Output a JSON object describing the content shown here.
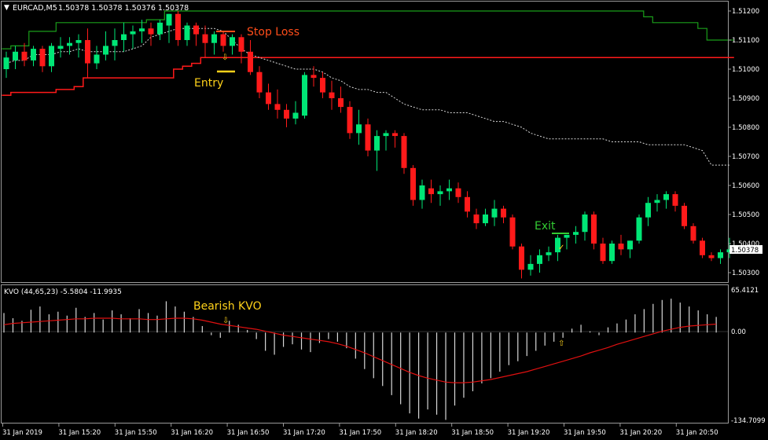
{
  "header": {
    "symbol": "EURCAD,M5",
    "ohlc": "1.50378 1.50378 1.50376 1.50378"
  },
  "annotations": {
    "stop_loss": "Stop Loss",
    "entry": "Entry",
    "exit": "Exit",
    "bearish_kvo": "Bearish KVO"
  },
  "indicator": {
    "label": "KVO (44,65,23)  -5.5804 -11.9935",
    "max_label": "65.4121",
    "zero_label": "0.00",
    "min_label": "-134.7099"
  },
  "current_price": "1.50378",
  "colors": {
    "bull": "#00e676",
    "bear": "#ff1a1a",
    "upper_band": "#1a9e1a",
    "lower_band": "#ff1a1a",
    "mid_band": "#d8d8d8",
    "kvo_hist": "#d8d8d8",
    "kvo_signal": "#e01010",
    "annotation_stop": "#ff4d1a",
    "annotation_entry": "#ffd21a",
    "annotation_exit": "#33cc33"
  },
  "chart_data": [
    {
      "type": "candlestick",
      "title": "EURCAD,M5",
      "ylim": [
        1.5025,
        1.5125
      ],
      "price_ticks": [
        "1.51200",
        "1.51100",
        "1.51000",
        "1.50900",
        "1.50800",
        "1.50700",
        "1.50600",
        "1.50500",
        "1.50400",
        "1.50300"
      ],
      "x_ticks": [
        "31 Jan 2019",
        "31 Jan 15:20",
        "31 Jan 15:50",
        "31 Jan 16:20",
        "31 Jan 16:50",
        "31 Jan 17:20",
        "31 Jan 17:50",
        "31 Jan 18:20",
        "31 Jan 18:50",
        "31 Jan 19:20",
        "31 Jan 19:50",
        "31 Jan 20:20",
        "31 Jan 20:50"
      ],
      "candles": [
        [
          1.51,
          1.5106,
          1.5097,
          1.5104
        ],
        [
          1.5103,
          1.5108,
          1.51,
          1.5106
        ],
        [
          1.5106,
          1.5109,
          1.5101,
          1.5103
        ],
        [
          1.5103,
          1.5108,
          1.5101,
          1.5107
        ],
        [
          1.5107,
          1.5108,
          1.5099,
          1.5101
        ],
        [
          1.5101,
          1.5109,
          1.5099,
          1.5108
        ],
        [
          1.5107,
          1.5111,
          1.5104,
          1.5108
        ],
        [
          1.5108,
          1.5111,
          1.5105,
          1.5109
        ],
        [
          1.5109,
          1.5112,
          1.5104,
          1.511
        ],
        [
          1.511,
          1.5114,
          1.5097,
          1.5102
        ],
        [
          1.5102,
          1.5108,
          1.51,
          1.5105
        ],
        [
          1.5105,
          1.5113,
          1.5103,
          1.5108
        ],
        [
          1.5108,
          1.5114,
          1.5103,
          1.511
        ],
        [
          1.511,
          1.5116,
          1.5106,
          1.5112
        ],
        [
          1.5112,
          1.5115,
          1.5107,
          1.5113
        ],
        [
          1.5113,
          1.5117,
          1.5109,
          1.5114
        ],
        [
          1.5114,
          1.5116,
          1.5108,
          1.5112
        ],
        [
          1.5112,
          1.5117,
          1.511,
          1.5116
        ],
        [
          1.5115,
          1.5119,
          1.5109,
          1.5119
        ],
        [
          1.5119,
          1.512,
          1.5108,
          1.511
        ],
        [
          1.511,
          1.5116,
          1.5108,
          1.5115
        ],
        [
          1.5115,
          1.5116,
          1.5108,
          1.5112
        ],
        [
          1.5112,
          1.5115,
          1.5104,
          1.5109
        ],
        [
          1.5109,
          1.5113,
          1.5105,
          1.5112
        ],
        [
          1.5112,
          1.5113,
          1.5106,
          1.5108
        ],
        [
          1.5108,
          1.5112,
          1.5105,
          1.5111
        ],
        [
          1.5111,
          1.5112,
          1.5102,
          1.5106
        ],
        [
          1.5106,
          1.511,
          1.5098,
          1.5099
        ],
        [
          1.5099,
          1.5101,
          1.509,
          1.5092
        ],
        [
          1.5092,
          1.5095,
          1.5086,
          1.5088
        ],
        [
          1.5088,
          1.5093,
          1.5083,
          1.5086
        ],
        [
          1.5086,
          1.5088,
          1.508,
          1.5083
        ],
        [
          1.5083,
          1.5089,
          1.5081,
          1.5085
        ],
        [
          1.5084,
          1.5099,
          1.5083,
          1.5098
        ],
        [
          1.5098,
          1.5101,
          1.5094,
          1.5097
        ],
        [
          1.5097,
          1.5099,
          1.509,
          1.5092
        ],
        [
          1.5092,
          1.5096,
          1.5086,
          1.509
        ],
        [
          1.509,
          1.5094,
          1.5085,
          1.5087
        ],
        [
          1.5087,
          1.5089,
          1.5076,
          1.5078
        ],
        [
          1.5078,
          1.5086,
          1.5074,
          1.5081
        ],
        [
          1.5081,
          1.5083,
          1.507,
          1.5072
        ],
        [
          1.5072,
          1.5079,
          1.5065,
          1.5077
        ],
        [
          1.5077,
          1.5079,
          1.5072,
          1.5078
        ],
        [
          1.5078,
          1.5079,
          1.5073,
          1.5077
        ],
        [
          1.5077,
          1.5078,
          1.5064,
          1.5066
        ],
        [
          1.5066,
          1.5067,
          1.5053,
          1.5055
        ],
        [
          1.5055,
          1.5062,
          1.5052,
          1.506
        ],
        [
          1.5059,
          1.5062,
          1.5054,
          1.5057
        ],
        [
          1.5057,
          1.506,
          1.5053,
          1.5058
        ],
        [
          1.5058,
          1.5062,
          1.5055,
          1.5059
        ],
        [
          1.5059,
          1.5061,
          1.5054,
          1.5056
        ],
        [
          1.5056,
          1.5058,
          1.5049,
          1.5051
        ],
        [
          1.505,
          1.5052,
          1.5045,
          1.5047
        ],
        [
          1.5047,
          1.5052,
          1.5046,
          1.505
        ],
        [
          1.5049,
          1.5055,
          1.5046,
          1.5052
        ],
        [
          1.5052,
          1.5053,
          1.5047,
          1.5049
        ],
        [
          1.5049,
          1.505,
          1.5038,
          1.5039
        ],
        [
          1.5039,
          1.504,
          1.5028,
          1.5031
        ],
        [
          1.5031,
          1.5036,
          1.5029,
          1.5033
        ],
        [
          1.5033,
          1.5038,
          1.503,
          1.5036
        ],
        [
          1.5036,
          1.5039,
          1.5034,
          1.5037
        ],
        [
          1.5037,
          1.5043,
          1.5034,
          1.5042
        ],
        [
          1.5042,
          1.5043,
          1.5038,
          1.5043
        ],
        [
          1.5043,
          1.5046,
          1.504,
          1.5044
        ],
        [
          1.5044,
          1.5051,
          1.5041,
          1.505
        ],
        [
          1.505,
          1.5051,
          1.5038,
          1.504
        ],
        [
          1.504,
          1.5042,
          1.5033,
          1.5034
        ],
        [
          1.5034,
          1.5041,
          1.5033,
          1.504
        ],
        [
          1.504,
          1.5043,
          1.5036,
          1.5038
        ],
        [
          1.5038,
          1.5041,
          1.5035,
          1.5041
        ],
        [
          1.5041,
          1.505,
          1.504,
          1.5049
        ],
        [
          1.5049,
          1.5056,
          1.5046,
          1.5054
        ],
        [
          1.5054,
          1.5057,
          1.5051,
          1.5055
        ],
        [
          1.5055,
          1.5058,
          1.5052,
          1.5057
        ],
        [
          1.5057,
          1.5058,
          1.5051,
          1.5053
        ],
        [
          1.5053,
          1.5054,
          1.5045,
          1.5046
        ],
        [
          1.5046,
          1.5047,
          1.504,
          1.5041
        ],
        [
          1.5041,
          1.5042,
          1.5035,
          1.5036
        ],
        [
          1.5036,
          1.5037,
          1.5034,
          1.5035
        ],
        [
          1.5035,
          1.5038,
          1.5033,
          1.5037
        ],
        [
          1.5037,
          1.5042,
          1.5035,
          1.5038
        ]
      ],
      "upper_band": [
        1.5107,
        1.5108,
        1.5108,
        1.5113,
        1.5113,
        1.5113,
        1.5116,
        1.5116,
        1.5116,
        1.5116,
        1.5116,
        1.5116,
        1.5116,
        1.5116,
        1.5116,
        1.5116,
        1.5117,
        1.5117,
        1.512,
        1.512,
        1.512,
        1.512,
        1.512,
        1.512,
        1.512,
        1.512,
        1.512,
        1.512,
        1.512,
        1.512,
        1.512,
        1.512,
        1.512,
        1.512,
        1.512,
        1.512,
        1.512,
        1.512,
        1.512,
        1.512,
        1.512,
        1.512,
        1.512,
        1.512,
        1.512,
        1.512,
        1.512,
        1.512,
        1.512,
        1.512,
        1.512,
        1.512,
        1.512,
        1.512,
        1.512,
        1.512,
        1.512,
        1.512,
        1.512,
        1.512,
        1.512,
        1.512,
        1.512,
        1.512,
        1.512,
        1.512,
        1.512,
        1.512,
        1.512,
        1.512,
        1.512,
        1.5118,
        1.5116,
        1.5116,
        1.5116,
        1.5116,
        1.5116,
        1.5114,
        1.511,
        1.511,
        1.511
      ],
      "mid_band": [
        1.5102,
        1.5103,
        1.5103,
        1.5105,
        1.5105,
        1.5105,
        1.5106,
        1.5106,
        1.5107,
        1.5106,
        1.5106,
        1.5106,
        1.5106,
        1.5106,
        1.5107,
        1.5108,
        1.5111,
        1.5112,
        1.5113,
        1.5114,
        1.5114,
        1.5114,
        1.5114,
        1.5114,
        1.5113,
        1.511,
        1.5107,
        1.5105,
        1.5104,
        1.5103,
        1.5102,
        1.5101,
        1.51,
        1.51,
        1.51,
        1.5099,
        1.5097,
        1.5096,
        1.5094,
        1.5093,
        1.5093,
        1.5092,
        1.5092,
        1.509,
        1.5088,
        1.5087,
        1.5086,
        1.5086,
        1.5086,
        1.5085,
        1.5085,
        1.5085,
        1.5084,
        1.5083,
        1.5082,
        1.5082,
        1.5081,
        1.508,
        1.5078,
        1.5077,
        1.5076,
        1.5076,
        1.5076,
        1.5076,
        1.5076,
        1.5076,
        1.5076,
        1.5075,
        1.5075,
        1.5075,
        1.5075,
        1.5074,
        1.5074,
        1.5074,
        1.5074,
        1.5074,
        1.5073,
        1.5072,
        1.5067,
        1.5067,
        1.5067
      ],
      "lower_band": [
        1.5091,
        1.5092,
        1.5092,
        1.5092,
        1.5092,
        1.5092,
        1.5093,
        1.5093,
        1.5094,
        1.5097,
        1.5097,
        1.5097,
        1.5097,
        1.5097,
        1.5097,
        1.5097,
        1.5097,
        1.5097,
        1.5097,
        1.51,
        1.5101,
        1.5102,
        1.5104,
        1.5104,
        1.5104,
        1.5104,
        1.5104,
        1.5104,
        1.5104,
        1.5104,
        1.5104,
        1.5104,
        1.5104,
        1.5104,
        1.5104,
        1.5104,
        1.5104,
        1.5104,
        1.5104,
        1.5104,
        1.5104,
        1.5104,
        1.5104,
        1.5104,
        1.5104,
        1.5104,
        1.5104,
        1.5104,
        1.5104,
        1.5104,
        1.5104,
        1.5104,
        1.5104,
        1.5104,
        1.5104,
        1.5104,
        1.5104,
        1.5104,
        1.5104,
        1.5104,
        1.5104,
        1.5104,
        1.5104,
        1.5104,
        1.5104,
        1.5104,
        1.5104,
        1.5104,
        1.5104,
        1.5104,
        1.5104,
        1.5104,
        1.5104,
        1.5104,
        1.5104,
        1.5104,
        1.5104,
        1.5104,
        1.5104,
        1.5104,
        1.5104
      ]
    },
    {
      "type": "bar",
      "title": "KVO (44,65,23)",
      "ylim": [
        -134.7099,
        65.4121
      ],
      "histogram": [
        30,
        22,
        18,
        35,
        40,
        28,
        32,
        26,
        38,
        24,
        30,
        20,
        34,
        28,
        22,
        36,
        30,
        26,
        48,
        40,
        32,
        24,
        10,
        -4,
        -8,
        18,
        12,
        4,
        -10,
        -28,
        -34,
        -22,
        -18,
        -26,
        -30,
        -16,
        -10,
        -14,
        -24,
        -40,
        -56,
        -70,
        -82,
        -96,
        -110,
        -124,
        -132,
        -118,
        -126,
        -134,
        -112,
        -100,
        -90,
        -78,
        -70,
        -60,
        -50,
        -44,
        -36,
        -28,
        -20,
        -14,
        -8,
        6,
        12,
        2,
        -4,
        8,
        14,
        20,
        28,
        36,
        44,
        50,
        52,
        46,
        40,
        34,
        28,
        24
      ],
      "signal": [
        12,
        14,
        15,
        16,
        17,
        18,
        19,
        20,
        21,
        21,
        22,
        22,
        22,
        21,
        21,
        21,
        20,
        20,
        21,
        22,
        22,
        21,
        19,
        16,
        13,
        11,
        9,
        7,
        5,
        2,
        -1,
        -4,
        -6,
        -8,
        -10,
        -12,
        -14,
        -17,
        -21,
        -26,
        -31,
        -37,
        -43,
        -49,
        -55,
        -61,
        -66,
        -70,
        -73,
        -76,
        -77,
        -77,
        -76,
        -74,
        -72,
        -69,
        -66,
        -63,
        -60,
        -56,
        -52,
        -48,
        -44,
        -40,
        -36,
        -31,
        -27,
        -23,
        -18,
        -14,
        -10,
        -6,
        -2,
        2,
        5,
        8,
        10,
        11,
        12,
        13
      ]
    }
  ]
}
